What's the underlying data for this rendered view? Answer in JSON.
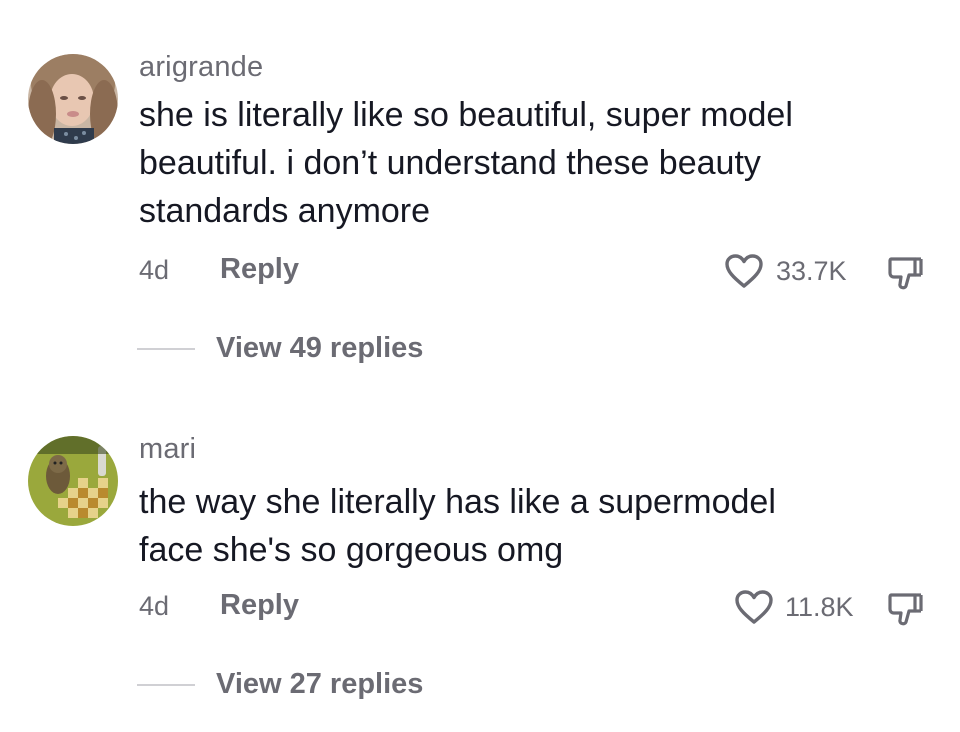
{
  "comments": [
    {
      "username": "arigrande",
      "text_lines": [
        "she is literally like so beautiful, super model",
        "beautiful. i don’t understand these beauty",
        "standards anymore"
      ],
      "time": "4d",
      "reply_label": "Reply",
      "like_count": "33.7K",
      "view_replies_label": "View 49 replies"
    },
    {
      "username": "mari",
      "text_lines": [
        "the way she literally has like a supermodel",
        "face she's so gorgeous omg"
      ],
      "time": "4d",
      "reply_label": "Reply",
      "like_count": "11.8K",
      "view_replies_label": "View 27 replies"
    }
  ],
  "colors": {
    "text_primary": "#161823",
    "text_secondary": "#6b6b73",
    "icon": "#6b6b73"
  },
  "icons": {
    "like": "heart-outline-icon",
    "dislike": "thumbs-down-outline-icon"
  }
}
